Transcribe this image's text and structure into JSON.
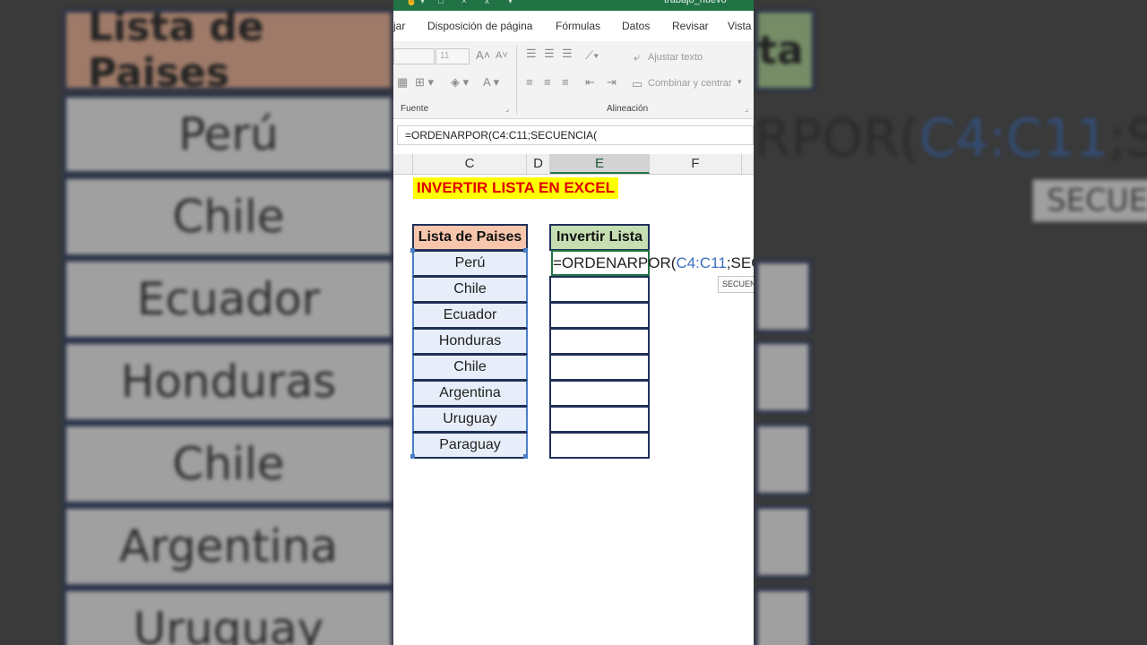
{
  "window": {
    "title": "trabajo_nuevo"
  },
  "ribbon_tabs": [
    "jar",
    "Disposición de página",
    "Fórmulas",
    "Datos",
    "Revisar",
    "Vista"
  ],
  "ribbon": {
    "font_size": "11",
    "wrap_text": "Ajustar texto",
    "merge_center": "Combinar y centrar",
    "group_font": "Fuente",
    "group_alignment": "Alineación"
  },
  "formula_bar": {
    "value": "=ORDENARPOR(C4:C11;SECUENCIA("
  },
  "columns": [
    "C",
    "D",
    "E",
    "F"
  ],
  "sheet": {
    "banner": "INVERTIR LISTA EN EXCEL",
    "header_left": "Lista de Paises",
    "header_right": "Invertir Lista",
    "countries": [
      "Perú",
      "Chile",
      "Ecuador",
      "Honduras",
      "Chile",
      "Argentina",
      "Uruguay",
      "Paraguay"
    ],
    "edit_formula_start": "=ORDENARPOR(",
    "edit_formula_ref": "C4:C11",
    "edit_formula_end": ";SECU",
    "tooltip": "SECUEN"
  },
  "background_zoom": {
    "header_left": "Lista de Paises",
    "header_right": "ta",
    "countries": [
      "Perú",
      "Chile",
      "Ecuador",
      "Honduras",
      "Chile",
      "Argentina",
      "Uruguay"
    ],
    "formula_start": "RPOR(",
    "formula_ref": "C4:C11",
    "formula_end": ";SECU",
    "tooltip": "SECUEN"
  },
  "colors": {
    "excel_green": "#217346",
    "header_orange": "#f7c6ac",
    "header_green": "#c5deb2",
    "banner_yellow": "#ffff00",
    "banner_red": "#e00000"
  }
}
